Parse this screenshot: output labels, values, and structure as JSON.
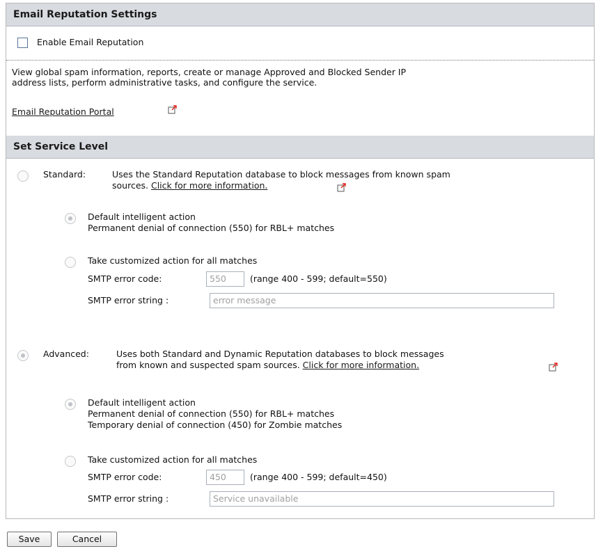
{
  "email_reputation": {
    "header": "Email Reputation Settings",
    "enable_label": "Enable Email Reputation",
    "enable_checked": false,
    "description_line1": "View global spam information, reports, create or manage Approved and Blocked Sender IP",
    "description_line2": "address lists, perform administrative tasks, and configure the service.",
    "portal_link": "Email Reputation Portal"
  },
  "service_level": {
    "header": "Set Service Level",
    "standard": {
      "label": "Standard:",
      "selected": false,
      "desc_line1": "Uses the Standard Reputation database to block messages from known spam",
      "desc_line2_prefix": "sources.",
      "more_info_link": "Click for more information.",
      "default_action": {
        "selected": true,
        "title": "Default intelligent action",
        "details": [
          "Permanent denial of connection (550) for RBL+ matches"
        ]
      },
      "custom_action": {
        "selected": false,
        "title": "Take customized action for all matches",
        "smtp_code_label": "SMTP error code:",
        "smtp_code_value": "550",
        "range_note": "(range 400 - 599; default=550)",
        "smtp_string_label": "SMTP error string :",
        "smtp_string_value": "error message"
      }
    },
    "advanced": {
      "label": "Advanced:",
      "selected": true,
      "desc_line1": "Uses both Standard and Dynamic Reputation databases to block messages",
      "desc_line2_prefix": "from known and suspected spam sources.",
      "more_info_link": "Click for more information.",
      "default_action": {
        "selected": true,
        "title": "Default intelligent action",
        "details": [
          "Permanent denial of connection (550) for RBL+ matches",
          "Temporary denial of connection (450) for Zombie matches"
        ]
      },
      "custom_action": {
        "selected": false,
        "title": "Take customized action for all matches",
        "smtp_code_label": "SMTP error code:",
        "smtp_code_value": "450",
        "range_note": "(range 400 - 599; default=450)",
        "smtp_string_label": "SMTP error string :",
        "smtp_string_value": "Service unavailable"
      }
    }
  },
  "buttons": {
    "save": "Save",
    "cancel": "Cancel"
  },
  "icons": {
    "external_link": "external-link-icon"
  },
  "colors": {
    "header_bg": "#d8dbe0",
    "ext_arrow": "#e2231a"
  }
}
